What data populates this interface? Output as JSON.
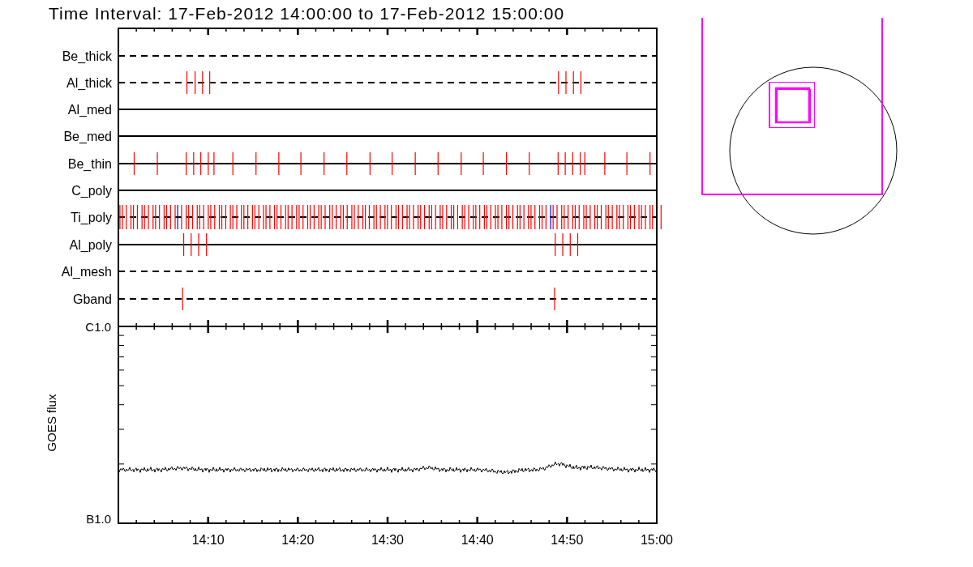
{
  "title": "Time Interval: 17-Feb-2012 14:00:00 to 17-Feb-2012 15:00:00",
  "filters": [
    {
      "label": "Be_thick",
      "dashed": true
    },
    {
      "label": "Al_thick",
      "dashed": true
    },
    {
      "label": "Al_med",
      "dashed": false
    },
    {
      "label": "Be_med",
      "dashed": false
    },
    {
      "label": "Be_thin",
      "dashed": false
    },
    {
      "label": "C_poly",
      "dashed": false
    },
    {
      "label": "Ti_poly",
      "dashed": true
    },
    {
      "label": "Al_poly",
      "dashed": false
    },
    {
      "label": "Al_mesh",
      "dashed": true
    },
    {
      "label": "Gband",
      "dashed": true
    }
  ],
  "goes_panel": {
    "ylabel": "GOES flux",
    "y_top_label": "C1.0",
    "y_bottom_label": "B1.0",
    "x_tick_labels": [
      "14:10",
      "14:20",
      "14:30",
      "14:40",
      "14:50",
      "15:00"
    ]
  }
}
